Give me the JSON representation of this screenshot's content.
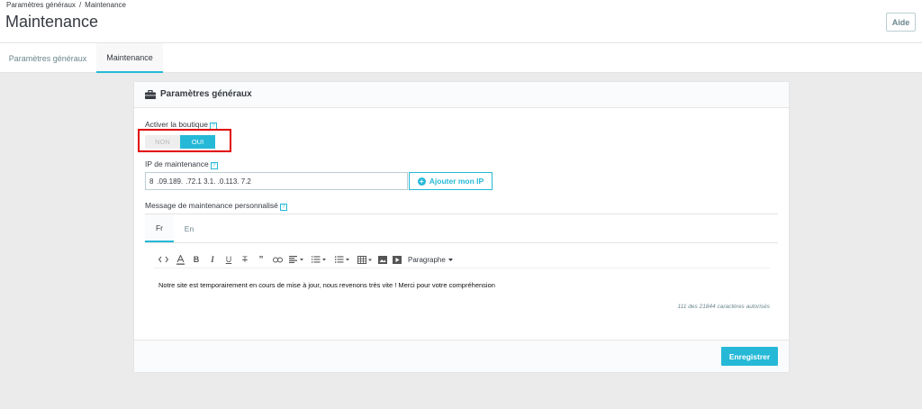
{
  "breadcrumb": {
    "parent": "Paramètres généraux",
    "separator": "/",
    "current": "Maintenance"
  },
  "page_title": "Maintenance",
  "help_button": "Aide",
  "tabs": [
    {
      "label": "Paramètres généraux",
      "active": false
    },
    {
      "label": "Maintenance",
      "active": true
    }
  ],
  "panel": {
    "title": "Paramètres généraux",
    "title_icon": "briefcase-icon",
    "help_icon_text": "?",
    "enable_shop": {
      "label": "Activer la boutique",
      "off_label": "NON",
      "on_label": "OUI",
      "value": "OUI"
    },
    "maintenance_ip": {
      "label": "IP de maintenance",
      "value": "8     .09.189.         .72.1       3.1.    .0.113.          7.2",
      "add_button": "Ajouter mon IP",
      "add_icon": "plus-circle-icon"
    },
    "message": {
      "label": "Message de maintenance personnalisé",
      "languages": [
        {
          "label": "Fr",
          "active": true
        },
        {
          "label": "En",
          "active": false
        }
      ],
      "format_select": "Paragraphe",
      "content": "Notre site est temporairement en cours de mise à jour, nous revenons très vite ! Merci pour votre compréhension",
      "char_count": "111 des 21844 caractères autorisés"
    },
    "save_button": "Enregistrer"
  },
  "colors": {
    "accent": "#25b9d7",
    "highlight_box": "#e10000",
    "background": "#ebebeb"
  }
}
